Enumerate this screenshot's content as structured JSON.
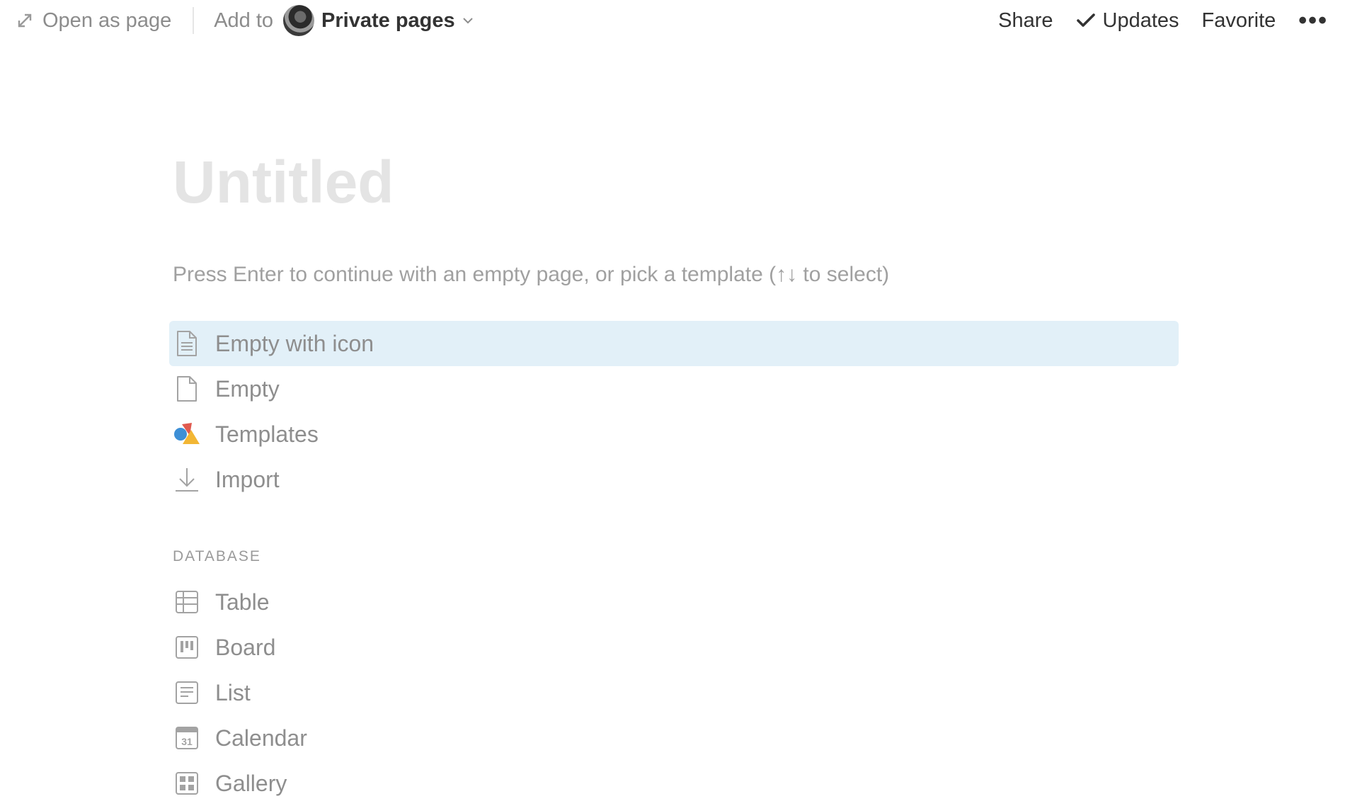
{
  "topbar": {
    "open_as_page": "Open as page",
    "add_to": "Add to",
    "workspace": "Private pages",
    "share": "Share",
    "updates": "Updates",
    "favorite": "Favorite",
    "more": "•••"
  },
  "page": {
    "title_placeholder": "Untitled",
    "hint": "Press Enter to continue with an empty page, or pick a template (↑↓ to select)"
  },
  "templates": [
    {
      "label": "Empty with icon",
      "icon": "page-lines-icon",
      "selected": true
    },
    {
      "label": "Empty",
      "icon": "page-icon",
      "selected": false
    },
    {
      "label": "Templates",
      "icon": "shapes-icon",
      "selected": false
    },
    {
      "label": "Import",
      "icon": "download-icon",
      "selected": false
    }
  ],
  "database": {
    "section_label": "DATABASE",
    "items": [
      {
        "label": "Table",
        "icon": "table-icon"
      },
      {
        "label": "Board",
        "icon": "board-icon"
      },
      {
        "label": "List",
        "icon": "list-icon"
      },
      {
        "label": "Calendar",
        "icon": "calendar-icon",
        "icon_text": "31"
      },
      {
        "label": "Gallery",
        "icon": "gallery-icon"
      }
    ]
  },
  "colors": {
    "selection_bg": "#e2f0f8",
    "text_dark": "#333333",
    "text_muted": "#8e8e8e",
    "title_placeholder": "#e4e4e4",
    "shape_red": "#e05a4f",
    "shape_blue": "#3d8fd6",
    "shape_yellow": "#f2b634"
  }
}
